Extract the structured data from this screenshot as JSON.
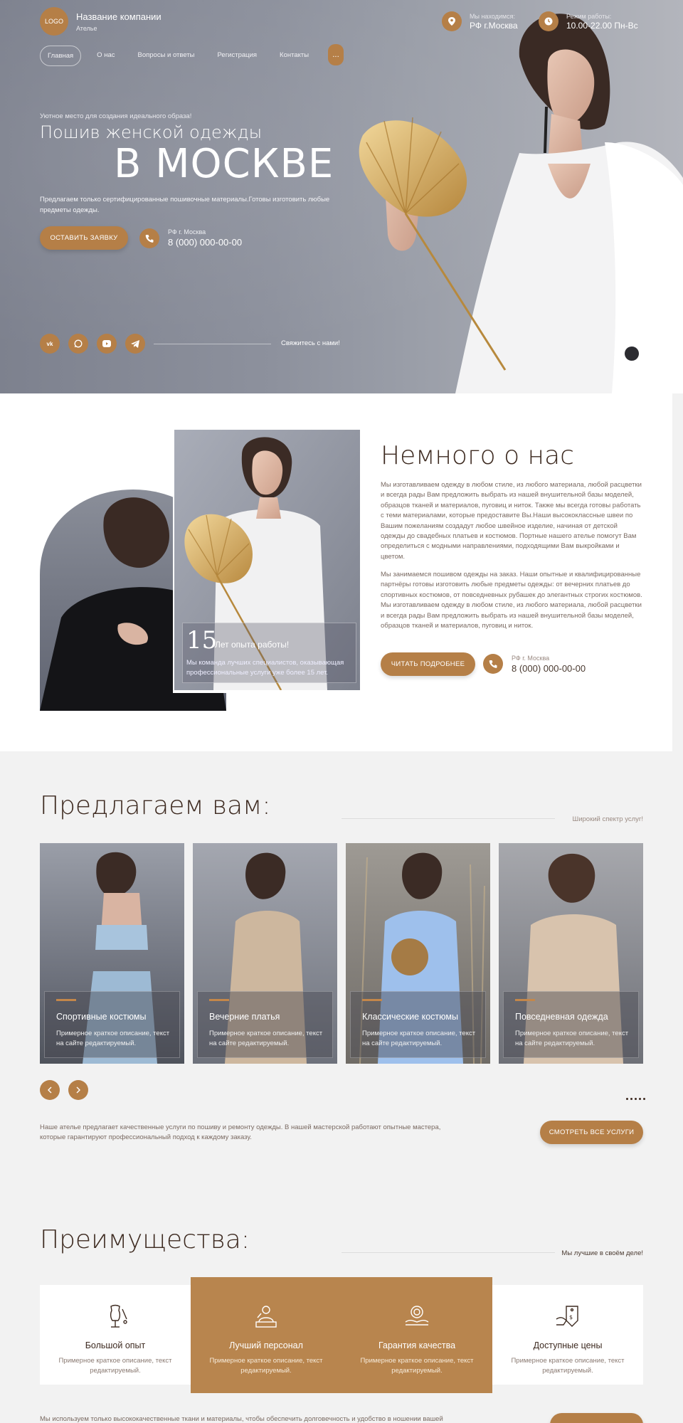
{
  "header": {
    "logo": "LOGO",
    "company_name": "Название компании",
    "company_sub": "Ателье",
    "location_label": "Мы находимся:",
    "location_value": "РФ г.Москва",
    "hours_label": "Режим работы:",
    "hours_value": "10.00-22.00 Пн-Вс",
    "nav": [
      "Главная",
      "О нас",
      "Вопросы и ответы",
      "Регистрация",
      "Контакты"
    ],
    "nav_more": "..."
  },
  "hero": {
    "tagline": "Уютное место для создания идеального образа!",
    "title_line1": "Пошив женской одежды",
    "title_line2": "В МОСКВЕ",
    "description": "Предлагаем только сертифицированные пошивочные материалы.Готовы изготовить любые предметы одежды.",
    "cta": "ОСТАВИТЬ ЗАЯВКУ",
    "phone_label": "РФ г. Москва",
    "phone": "8 (000) 000-00-00",
    "social": [
      "vk",
      "whatsapp",
      "youtube",
      "telegram"
    ],
    "social_label": "Свяжитесь с нами!"
  },
  "about": {
    "title": "Немного о нас",
    "p1": "Мы изготавливаем одежду в любом стиле, из любого материала, любой расцветки и всегда рады Вам предложить выбрать из нашей внушительной базы моделей, образцов тканей и материалов, пуговиц и ниток. Также мы всегда готовы работать с теми материалами, которые предоставите Вы.Наши высококлассные швеи по Вашим пожеланиям создадут любое швейное изделие, начиная от детской одежды до свадебных платьев и костюмов. Портные нашего ателье помогут Вам определиться с модными направлениями, подходящими Вам выкройками и цветом.",
    "p2": "Мы занимаемся пошивом одежды на заказ. Наши опытные и квалифицированные партнёры готовы изготовить любые предметы одежды: от вечерних платьев до спортивных костюмов, от повседневных рубашек до элегантных строгих костюмов. Мы изготавливаем одежду в любом стиле, из любого материала, любой расцветки и всегда рады Вам предложить выбрать из нашей внушительной базы моделей, образцов тканей и материалов, пуговиц и ниток.",
    "cta": "ЧИТАТЬ ПОДРОБНЕЕ",
    "phone_label": "РФ г. Москва",
    "phone": "8 (000) 000-00-00",
    "exp_num": "15",
    "exp_title": "Лет опыта работы!",
    "exp_text": "Мы команда лучших специалистов, оказывающая профессиональные услуги уже более 15 лет."
  },
  "services": {
    "title": "Предлагаем вам:",
    "subtitle": "Широкий спектр услуг!",
    "cards": [
      {
        "title": "Спортивные костюмы",
        "text": "Примерное краткое описание, текст на сайте редактируемый."
      },
      {
        "title": "Вечерние платья",
        "text": "Примерное краткое описание, текст на сайте редактируемый."
      },
      {
        "title": "Классические костюмы",
        "text": "Примерное краткое описание, текст на сайте редактируемый."
      },
      {
        "title": "Повседневная одежда",
        "text": "Примерное краткое описание, текст на сайте редактируемый."
      }
    ],
    "footer_text": "Наше ателье предлагает качественные услуги по пошиву и ремонту одежды. В нашей мастерской работают опытные мастера, которые гарантируют профессиональный подход к каждому заказу.",
    "cta": "СМОТРЕТЬ ВСЕ УСЛУГИ"
  },
  "advantages": {
    "title": "Преимущества:",
    "subtitle": "Мы лучшие в своём деле!",
    "items": [
      {
        "title": "Большой опыт",
        "text": "Примерное краткое описание, текст редактируемый.",
        "icon": "mannequin-icon"
      },
      {
        "title": "Лучший персонал",
        "text": "Примерное краткое описание, текст редактируемый.",
        "icon": "staff-icon"
      },
      {
        "title": "Гарантия качества",
        "text": "Примерное краткое описание, текст редактируемый.",
        "icon": "quality-icon"
      },
      {
        "title": "Доступные цены",
        "text": "Примерное краткое описание, текст редактируемый.",
        "icon": "price-tag-icon"
      }
    ],
    "footer_text": "Мы используем только высококачественные ткани и материалы, чтобы обеспечить долговечность и удобство в ношении вашей"
  },
  "colors": {
    "accent": "#b57f47",
    "dark": "#3d2a20"
  }
}
